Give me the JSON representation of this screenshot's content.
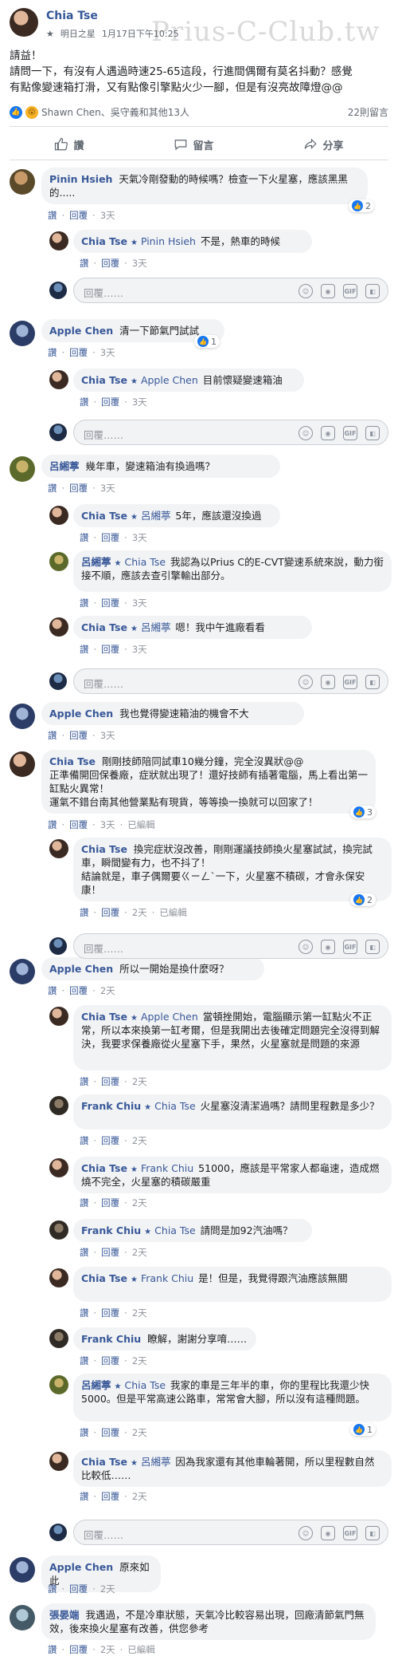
{
  "post": {
    "author": "Chia Tse",
    "group": "明日之星",
    "time": "1月17日下午10:25",
    "watermark": "Prius-C-Club.tw",
    "text_lines": [
      "請益！",
      "請問一下，有沒有人遇過時速25-65這段，行進間偶爾有莫名抖動？感覺",
      "有點像變速箱打滑，又有點像引擎點火少一腳，但是有沒亮故障燈@@"
    ],
    "reactions_text": "Shawn Chen、吳守義和其他13人",
    "comment_count": "22則留言",
    "actions": {
      "like": "讚",
      "comment": "留言",
      "share": "分享"
    }
  },
  "ui": {
    "reply": "回覆",
    "like": "讚",
    "reply_placeholder": "回覆……",
    "edited": "已編輯"
  },
  "comments": [
    {
      "name": "Pinin Hsieh",
      "text": "天氣冷剛發動的時候嗎？檢查一下火星塞，應該黑黑的.....",
      "time": "3天",
      "likes": "2"
    },
    {
      "name": "Chia Tse",
      "mention": "Pinin Hsieh",
      "text": "不是，熱車的時候",
      "time": "3天"
    },
    {
      "name": "Apple Chen",
      "text": "清一下節氣門試試",
      "time": "3天",
      "likes": "1"
    },
    {
      "name": "Chia Tse",
      "mention": "Apple Chen",
      "text": "目前懷疑變速箱油",
      "time": "3天"
    },
    {
      "name": "呂緗葶",
      "text": "幾年車，變速箱油有換過嗎？",
      "time": "3天"
    },
    {
      "name": "Chia Tse",
      "mention": "呂緗葶",
      "text": "5年，應該還沒換過",
      "time": "3天"
    },
    {
      "name": "呂緗葶",
      "mention": "Chia Tse",
      "text": "我認為以Prius C的E-CVT變速系統來說，動力銜接不順，應該去查引擎輸出部分。",
      "time": "3天"
    },
    {
      "name": "Chia Tse",
      "mention": "呂緗葶",
      "text": "嗯！我中午進廠看看",
      "time": "3天"
    },
    {
      "name": "Apple Chen",
      "text": "我也覺得變速箱油的機會不大",
      "time": "3天"
    },
    {
      "name": "Chia Tse",
      "text": "剛剛技師陪同試車10幾分鐘，完全沒異狀@@\n正準備開回保養廠，症狀就出現了！還好技師有插著電腦，馬上看出第一缸點火異常！\n運氣不錯台南其他營業點有現貨，等等換一換就可以回家了！",
      "time": "3天",
      "edited": true,
      "likes": "3"
    },
    {
      "name": "Chia Tse",
      "text": "換完症狀沒改善，剛剛運議技師換火星塞試試，換完試車，瞬間變有力，也不抖了！\n結論就是，車子偶爾要ㄍㄧㄥˋ一下，火星塞不積碳，才會永保安康！",
      "time": "2天",
      "edited": true,
      "likes": "2"
    },
    {
      "name": "Apple Chen",
      "text": "所以一開始是換什麼呀？",
      "time": "2天"
    },
    {
      "name": "Chia Tse",
      "mention": "Apple Chen",
      "text": "當頓挫開始，電腦顯示第一缸點火不正常，所以本來換第一缸考爾，但是我開出去後確定問題完全沒得到解決，我要求保養廠從火星塞下手，果然，火星塞就是問題的來源",
      "time": "2天"
    },
    {
      "name": "Frank Chiu",
      "mention": "Chia Tse",
      "text": "火星塞沒清潔過嗎？請問里程數是多少？",
      "time": "2天"
    },
    {
      "name": "Chia Tse",
      "mention": "Frank Chiu",
      "text": "51000，應該是平常家人都龜速，造成燃燒不完全，火星塞的積碳嚴重",
      "time": "2天"
    },
    {
      "name": "Frank Chiu",
      "mention": "Chia Tse",
      "text": "請問是加92汽油嗎？",
      "time": "2天"
    },
    {
      "name": "Chia Tse",
      "mention": "Frank Chiu",
      "text": "是！但是，我覺得跟汽油應該無關",
      "time": "2天"
    },
    {
      "name": "Frank Chiu",
      "text": "瞭解，謝謝分享唷……",
      "time": "2天"
    },
    {
      "name": "呂緗葶",
      "mention": "Chia Tse",
      "text": "我家的車是三年半的車，你的里程比我還少快5000。但是平常高速公路車，常常會大腳，所以沒有這種問題。",
      "time": "2天",
      "likes": "1"
    },
    {
      "name": "Chia Tse",
      "mention": "呂緗葶",
      "text": "因為我家還有其他車輪著開，所以里程數自然比較低……",
      "time": "2天"
    },
    {
      "name": "Apple Chen",
      "text": "原來如此",
      "time": "2天"
    },
    {
      "name": "張晏端",
      "text": "我遇過，不是冷車狀態，天氣冷比較容易出現，回廠清節氣門無效，後來換火星塞有改善，供您參考",
      "time": "2天",
      "edited": true
    }
  ]
}
